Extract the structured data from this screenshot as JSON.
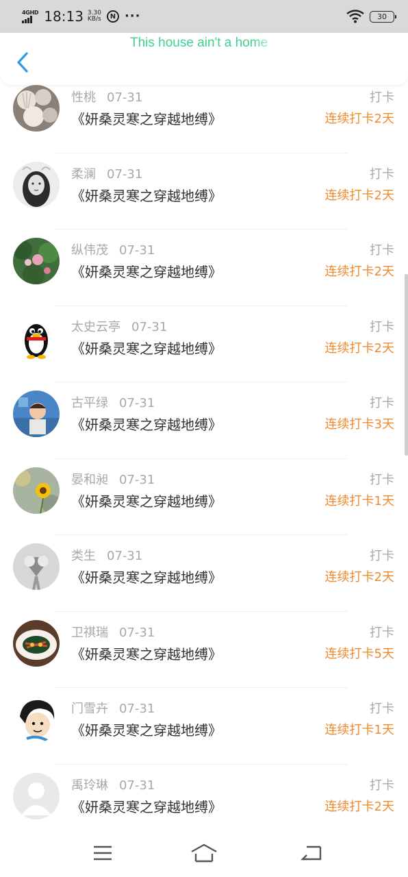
{
  "status_bar": {
    "network": "4GHD",
    "time": "18:13",
    "speed_value": "3.30",
    "speed_unit": "KB/s",
    "badge": "N",
    "dots": "···",
    "battery": "30",
    "icons": [
      "signal-icon",
      "nfc-icon",
      "wifi-icon",
      "battery-icon"
    ]
  },
  "header": {
    "title": "This house ain't a home",
    "back_icon": "chevron-left-icon"
  },
  "colors": {
    "title_green": "#3fd18d",
    "back_blue": "#2c9be6",
    "streak_orange": "#ee8a2e",
    "muted_gray": "#a8a8a8",
    "text_dark": "#333333"
  },
  "entries": [
    {
      "name": "性桃",
      "date": "07-31",
      "book": "《妍桑灵寒之穿越地缚》",
      "kind": "打卡",
      "streak": "连续打卡2天",
      "avatar": "shells-avatar"
    },
    {
      "name": "柔澜",
      "date": "07-31",
      "book": "《妍桑灵寒之穿越地缚》",
      "kind": "打卡",
      "streak": "连续打卡2天",
      "avatar": "girl-bw-avatar"
    },
    {
      "name": "纵伟茂",
      "date": "07-31",
      "book": "《妍桑灵寒之穿越地缚》",
      "kind": "打卡",
      "streak": "连续打卡2天",
      "avatar": "lotus-avatar"
    },
    {
      "name": "太史云亭",
      "date": "07-31",
      "book": "《妍桑灵寒之穿越地缚》",
      "kind": "打卡",
      "streak": "连续打卡2天",
      "avatar": "penguin-avatar"
    },
    {
      "name": "古平绿",
      "date": "07-31",
      "book": "《妍桑灵寒之穿越地缚》",
      "kind": "打卡",
      "streak": "连续打卡3天",
      "avatar": "child-avatar"
    },
    {
      "name": "晏和昶",
      "date": "07-31",
      "book": "《妍桑灵寒之穿越地缚》",
      "kind": "打卡",
      "streak": "连续打卡1天",
      "avatar": "sunflower-avatar"
    },
    {
      "name": "类生",
      "date": "07-31",
      "book": "《妍桑灵寒之穿越地缚》",
      "kind": "打卡",
      "streak": "连续打卡2天",
      "avatar": "heart-hands-avatar"
    },
    {
      "name": "卫祺瑞",
      "date": "07-31",
      "book": "《妍桑灵寒之穿越地缚》",
      "kind": "打卡",
      "streak": "连续打卡5天",
      "avatar": "dish-avatar"
    },
    {
      "name": "门雪卉",
      "date": "07-31",
      "book": "《妍桑灵寒之穿越地缚》",
      "kind": "打卡",
      "streak": "连续打卡1天",
      "avatar": "cartoon-avatar"
    },
    {
      "name": "禹玲琳",
      "date": "07-31",
      "book": "《妍桑灵寒之穿越地缚》",
      "kind": "打卡",
      "streak": "连续打卡2天",
      "avatar": "default-avatar"
    }
  ],
  "nav": {
    "items": [
      "menu-icon",
      "home-icon",
      "back-icon"
    ]
  }
}
